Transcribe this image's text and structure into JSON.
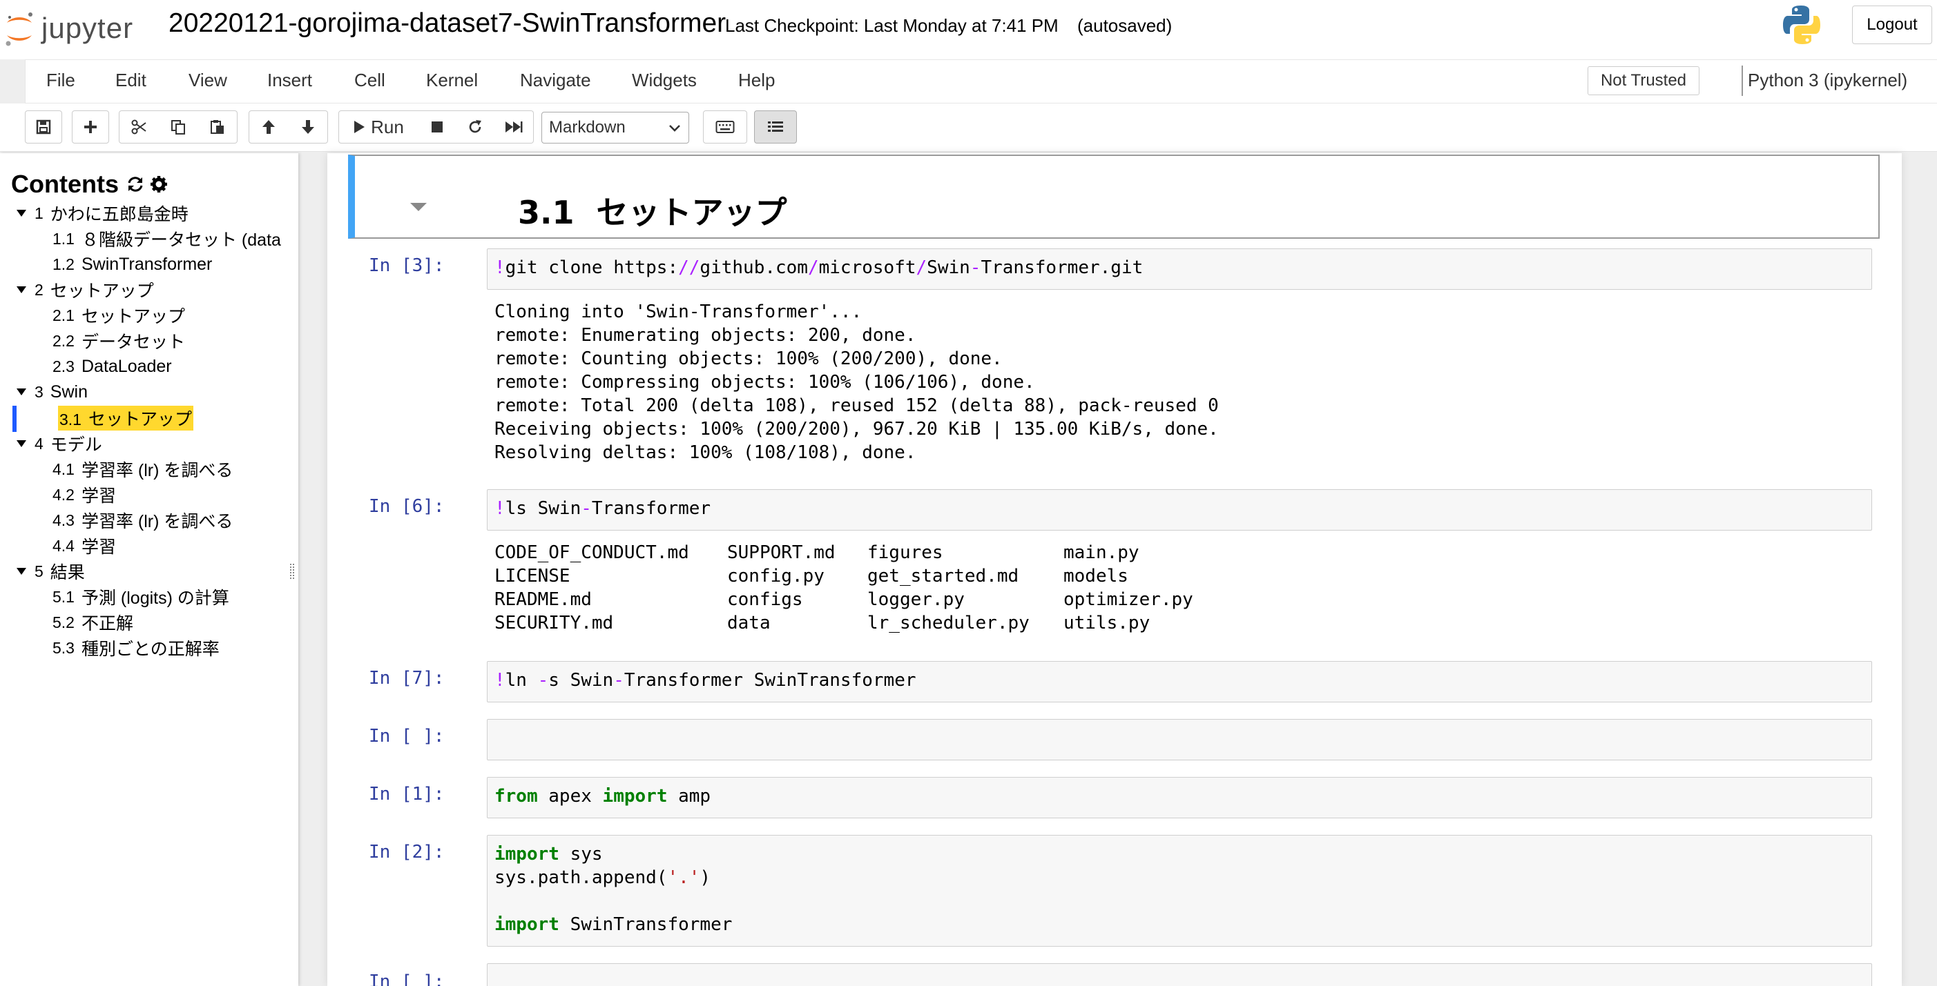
{
  "header": {
    "logo_text": "jupyter",
    "notebook_title": "20220121-gorojima-dataset7-SwinTransformer",
    "checkpoint": "Last Checkpoint: Last Monday at 7:41 PM",
    "autosave_status": "(autosaved)",
    "logout_label": "Logout"
  },
  "menubar": {
    "items": [
      "File",
      "Edit",
      "View",
      "Insert",
      "Cell",
      "Kernel",
      "Navigate",
      "Widgets",
      "Help"
    ],
    "trust_label": "Not Trusted",
    "kernel_name": "Python 3 (ipykernel)"
  },
  "toolbar": {
    "run_label": "Run",
    "cell_type": "Markdown"
  },
  "toc": {
    "title": "Contents",
    "items": [
      {
        "num": "1",
        "label": "かわに五郎島金時"
      },
      {
        "num": "1.1",
        "label": "８階級データセット (data"
      },
      {
        "num": "1.2",
        "label": "SwinTransformer"
      },
      {
        "num": "2",
        "label": "セットアップ"
      },
      {
        "num": "2.1",
        "label": "セットアップ"
      },
      {
        "num": "2.2",
        "label": "データセット"
      },
      {
        "num": "2.3",
        "label": "DataLoader"
      },
      {
        "num": "3",
        "label": "Swin"
      },
      {
        "num": "3.1",
        "label": "セットアップ"
      },
      {
        "num": "4",
        "label": "モデル"
      },
      {
        "num": "4.1",
        "label": "学習率 (lr) を調べる"
      },
      {
        "num": "4.2",
        "label": "学習"
      },
      {
        "num": "4.3",
        "label": "学習率 (lr) を調べる"
      },
      {
        "num": "4.4",
        "label": "学習"
      },
      {
        "num": "5",
        "label": "結果"
      },
      {
        "num": "5.1",
        "label": "予測 (logits) の計算"
      },
      {
        "num": "5.2",
        "label": "不正解"
      },
      {
        "num": "5.3",
        "label": "種別ごとの正解率"
      }
    ]
  },
  "notebook": {
    "heading_num": "3.1",
    "heading_text": "セットアップ",
    "cells": [
      {
        "prompt": "In [3]:"
      },
      {
        "prompt": "In [6]:"
      },
      {
        "prompt": "In [7]:"
      },
      {
        "prompt": "In [ ]:"
      },
      {
        "prompt": "In [1]:"
      },
      {
        "prompt": "In [2]:"
      },
      {
        "prompt": "In [ ]:"
      }
    ],
    "code": {
      "c3": {
        "bang": "!",
        "a": "git clone https:",
        "sl1": "//",
        "b": "github.com",
        "sl2": "/",
        "c": "microsoft",
        "sl3": "/",
        "d": "Swin",
        "dash": "-",
        "e": "Transformer.git"
      },
      "c6": {
        "bang": "!",
        "a": "ls Swin",
        "dash": "-",
        "b": "Transformer"
      },
      "c7": {
        "bang": "!",
        "a": "ln ",
        "dash": "-",
        "b": "s Swin",
        "dash2": "-",
        "c": "Transformer SwinTransformer"
      },
      "c1": {
        "kw1": "from",
        "a": " apex ",
        "kw2": "import",
        "b": " amp"
      },
      "c2": {
        "kw1": "import",
        "a": " sys",
        "b": "sys.path.append(",
        "s": "'.'",
        "c": ")",
        "kw2": "import",
        "d": " SwinTransformer"
      }
    },
    "output3": [
      "Cloning into 'Swin-Transformer'...",
      "remote: Enumerating objects: 200, done.",
      "remote: Counting objects: 100% (200/200), done.",
      "remote: Compressing objects: 100% (106/106), done.",
      "remote: Total 200 (delta 108), reused 152 (delta 88), pack-reused 0",
      "Receiving objects: 100% (200/200), 967.20 KiB | 135.00 KiB/s, done.",
      "Resolving deltas: 100% (108/108), done."
    ],
    "output6": [
      "CODE_OF_CONDUCT.md",
      "SUPPORT.md",
      "figures",
      "main.py",
      "LICENSE",
      "config.py",
      "get_started.md",
      "models",
      "README.md",
      "configs",
      "logger.py",
      "optimizer.py",
      "SECURITY.md",
      "data",
      "lr_scheduler.py",
      "utils.py"
    ]
  }
}
